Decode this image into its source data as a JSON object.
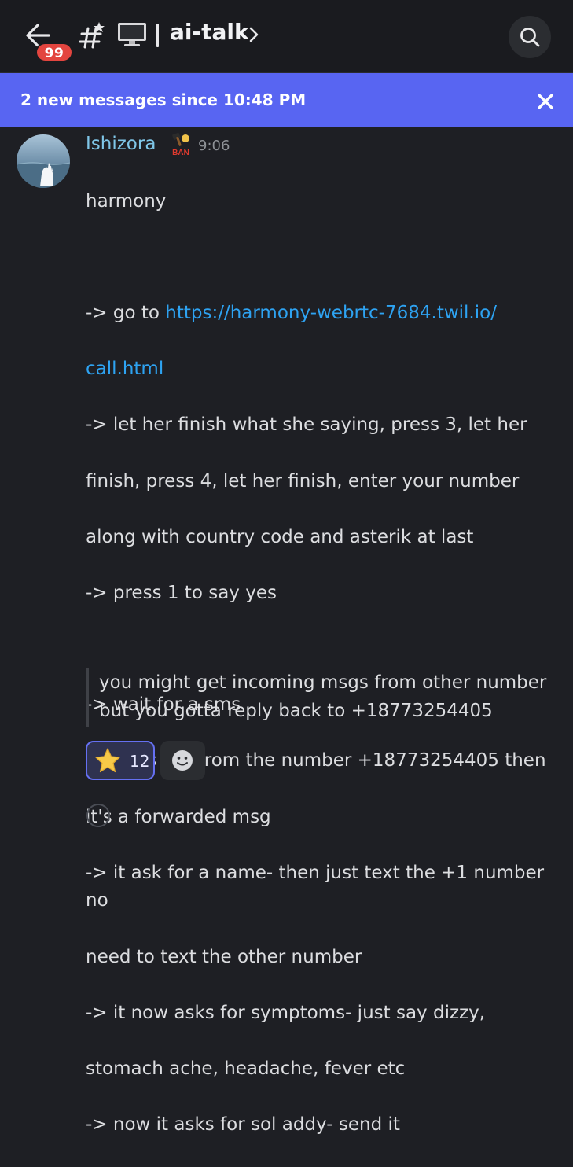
{
  "header": {
    "unread_count": "99",
    "channel_name": "ai-talk"
  },
  "banner": {
    "text": "2 new messages since 10:48 PM"
  },
  "message": {
    "author": "Ishizora",
    "role_badge_text": "BAN",
    "time": "9:06",
    "lines": [
      {
        "text": "harmony"
      },
      {
        "text": ""
      },
      {
        "prefix": "-> go to ",
        "link1": "https://harmony-webrtc-7684.twil.io/",
        "link2": "call.html"
      },
      {
        "text": "-> let her finish what she saying, press 3,  let her"
      },
      {
        "text": "finish,  press 4, let her finish, enter your number"
      },
      {
        "text": "along with country code and asterik at last"
      },
      {
        "text": "-> press 1 to say yes"
      },
      {
        "text": ""
      },
      {
        "text": "-> wait for a sms"
      },
      {
        "text": "-> if it's not from the number +18773254405 then"
      },
      {
        "text": "it's a forwarded msg"
      },
      {
        "text": "-> it ask for a name- then just text the +1 number no"
      },
      {
        "text": "need to text the other number"
      },
      {
        "text": "-> it now asks for symptoms- just say dizzy,"
      },
      {
        "text": "stomach ache, headache, fever etc"
      },
      {
        "text": "-> now it asks for sol addy- send it"
      }
    ],
    "quote_line1": "you might get incoming msgs from other number",
    "quote_line2": "but you gotta reply back to +18773254405"
  },
  "reactions": {
    "star_count": "12"
  },
  "colors": {
    "background": "#1e1f24",
    "banner": "#5865f2",
    "author": "#7fc6e8",
    "link": "#2ea3f2",
    "badge": "#e3453f"
  }
}
